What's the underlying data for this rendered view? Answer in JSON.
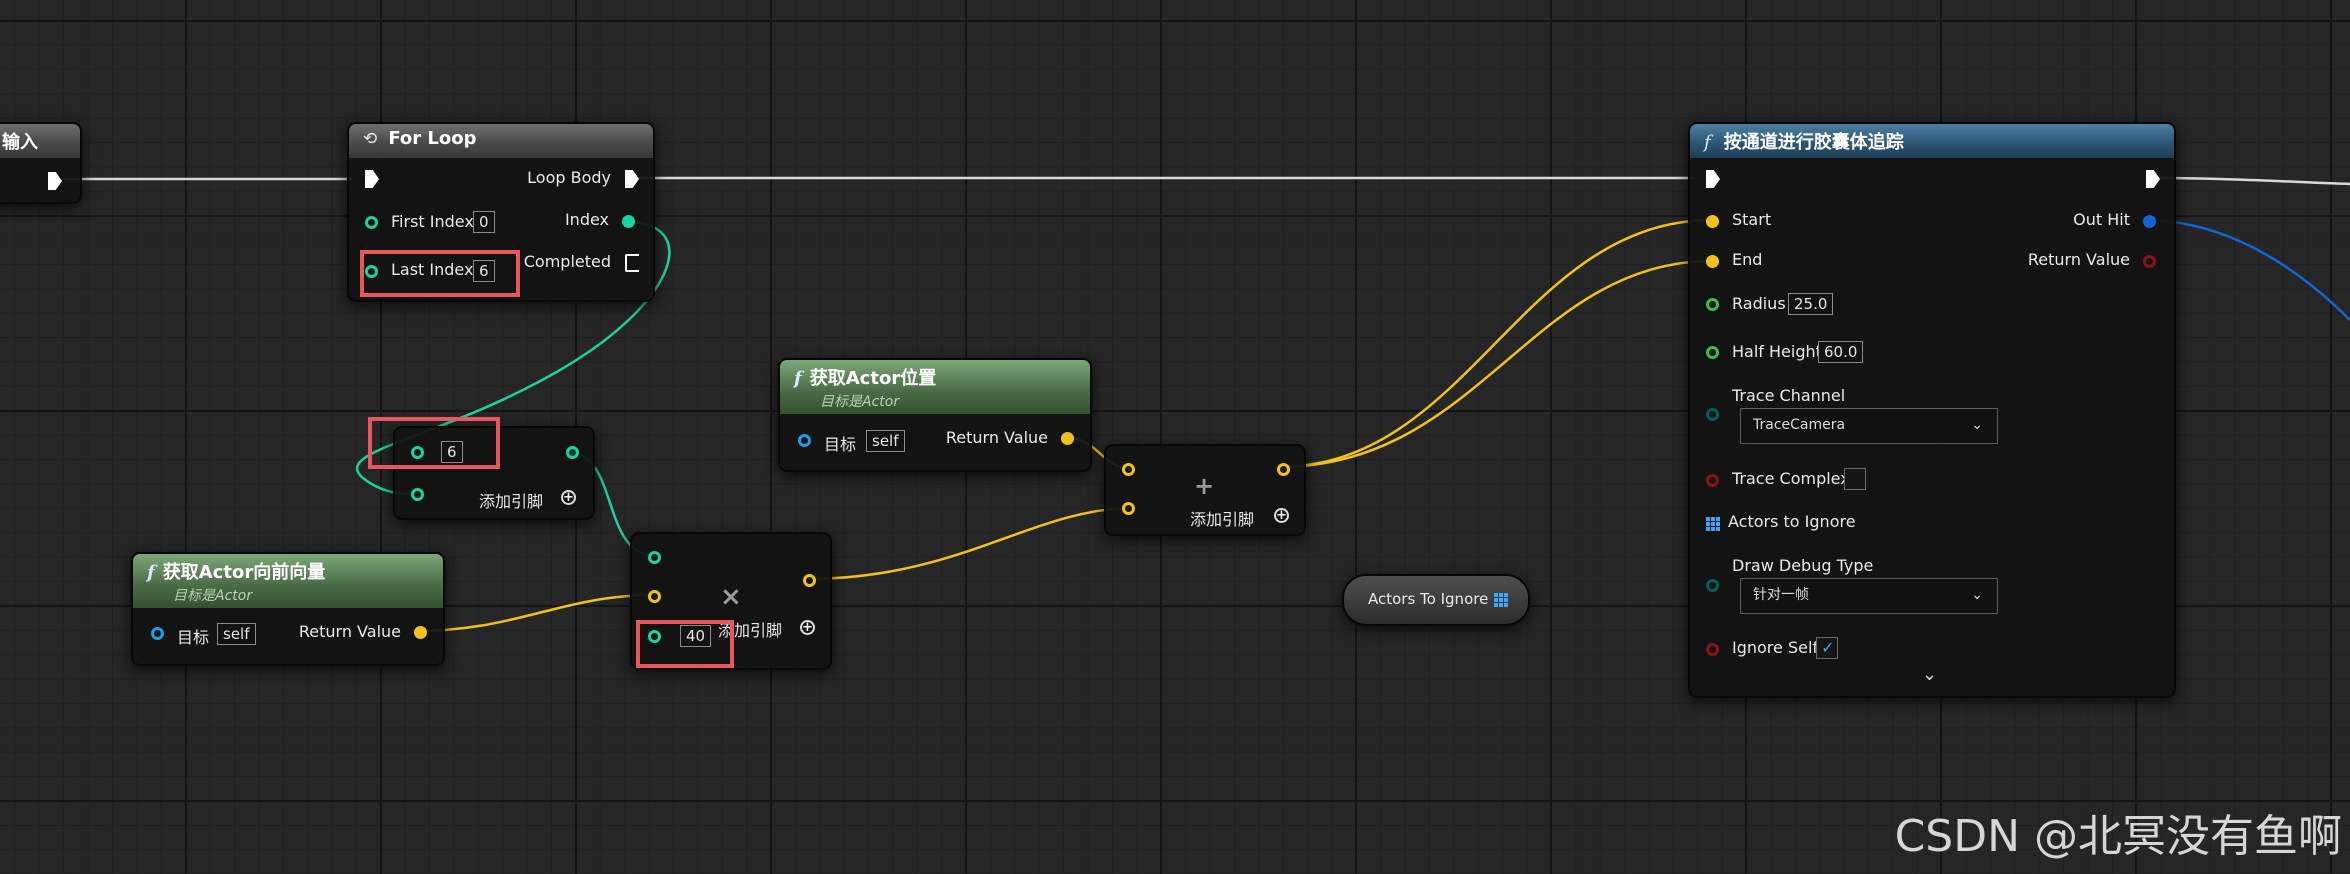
{
  "colors": {
    "exec": "#ffffff",
    "int_pin": "#1dd1a1",
    "vector_pin": "#f2c21b",
    "object_pin": "#1e9bea",
    "hit_pin": "#1565d8",
    "bool_pin": "#8b1414",
    "float_pin": "#3cc13c",
    "byte_pin": "#00605a",
    "highlight": "#e8575d"
  },
  "nodes": {
    "input_node": {
      "title": "输入"
    },
    "for_loop": {
      "title": "For Loop",
      "loop_body": "Loop Body",
      "first_index_label": "First Index",
      "first_index_value": "0",
      "index_label": "Index",
      "last_index_label": "Last Index",
      "last_index_value": "6",
      "completed_label": "Completed"
    },
    "add_int": {
      "value": "6",
      "add_pin_label": "添加引脚"
    },
    "get_actor_location": {
      "title": "获取Actor位置",
      "subtitle": "目标是Actor",
      "target_label": "目标",
      "target_value": "self",
      "return_label": "Return Value"
    },
    "get_forward_vector": {
      "title": "获取Actor向前向量",
      "subtitle": "目标是Actor",
      "target_label": "目标",
      "target_value": "self",
      "return_label": "Return Value"
    },
    "multiply": {
      "symbol": "×",
      "value": "40",
      "add_pin_label": "添加引脚"
    },
    "add_vector": {
      "symbol": "+",
      "add_pin_label": "添加引脚"
    },
    "actors_to_ignore_var": {
      "label": "Actors To Ignore"
    },
    "capsule_trace": {
      "title": "按通道进行胶囊体追踪",
      "start_label": "Start",
      "end_label": "End",
      "out_hit_label": "Out Hit",
      "return_label": "Return Value",
      "radius_label": "Radius",
      "radius_value": "25.0",
      "half_height_label": "Half Height",
      "half_height_value": "60.0",
      "trace_channel_label": "Trace Channel",
      "trace_channel_value": "TraceCamera",
      "trace_complex_label": "Trace Complex",
      "trace_complex_checked": false,
      "actors_to_ignore_label": "Actors to Ignore",
      "draw_debug_label": "Draw Debug Type",
      "draw_debug_value": "针对一帧",
      "ignore_self_label": "Ignore Self",
      "ignore_self_checked": true
    }
  },
  "watermark": "CSDN @北冥没有鱼啊"
}
